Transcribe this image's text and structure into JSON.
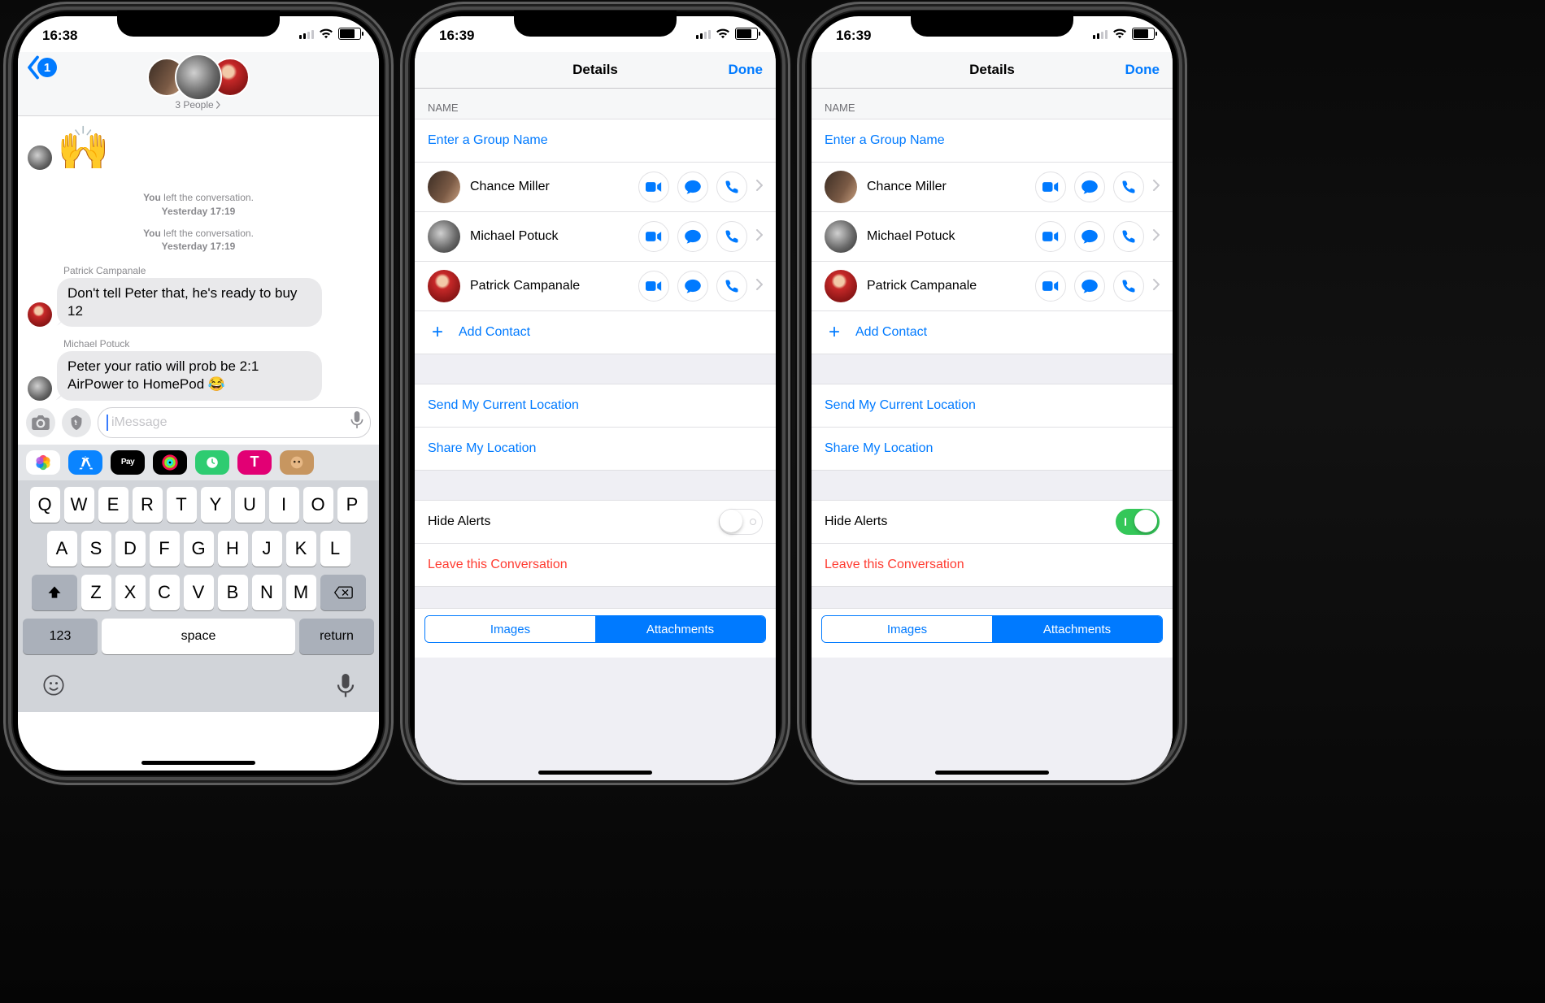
{
  "screen1": {
    "time": "16:38",
    "back_badge": "1",
    "subtitle": "3 People",
    "emoji_msg": "🙌",
    "sys1_line": "You left the conversation.",
    "sys1_ts": "Yesterday 17:19",
    "sys2_line": "You left the conversation.",
    "sys2_ts": "Yesterday 17:19",
    "msg1_sender": "Patrick Campanale",
    "msg1_text": "Don't tell Peter that, he's ready to buy 12",
    "msg2_sender": "Michael Potuck",
    "msg2_text": "Peter your ratio will prob be 2:1 AirPower to HomePod 😂",
    "compose_placeholder": "iMessage",
    "kb_rows": [
      [
        "Q",
        "W",
        "E",
        "R",
        "T",
        "Y",
        "U",
        "I",
        "O",
        "P"
      ],
      [
        "A",
        "S",
        "D",
        "F",
        "G",
        "H",
        "J",
        "K",
        "L"
      ],
      [
        "Z",
        "X",
        "C",
        "V",
        "B",
        "N",
        "M"
      ]
    ],
    "kb_numbers_label": "123",
    "kb_space_label": "space",
    "kb_return_label": "return",
    "apps": [
      {
        "name": "photos-app",
        "bg": "#ffffff"
      },
      {
        "name": "appstore-app",
        "bg": "#0a84ff"
      },
      {
        "name": "applepay-app",
        "bg": "#000000"
      },
      {
        "name": "activity-app",
        "bg": "#000000"
      },
      {
        "name": "clock-app",
        "bg": "#2ecc71"
      },
      {
        "name": "tmobile-app",
        "bg": "#e20074"
      },
      {
        "name": "animoji-app",
        "bg": "#f6d28a"
      }
    ]
  },
  "details_common": {
    "title": "Details",
    "done": "Done",
    "name_header": "NAME",
    "name_placeholder": "Enter a Group Name",
    "contacts": [
      {
        "name": "Chance Miller"
      },
      {
        "name": "Michael Potuck"
      },
      {
        "name": "Patrick Campanale"
      }
    ],
    "add_contact": "Add Contact",
    "send_location": "Send My Current Location",
    "share_location": "Share My Location",
    "hide_alerts": "Hide Alerts",
    "leave": "Leave this Conversation",
    "seg_images": "Images",
    "seg_attachments": "Attachments"
  },
  "screen2": {
    "time": "16:39",
    "hide_alerts_on": false
  },
  "screen3": {
    "time": "16:39",
    "hide_alerts_on": true
  }
}
